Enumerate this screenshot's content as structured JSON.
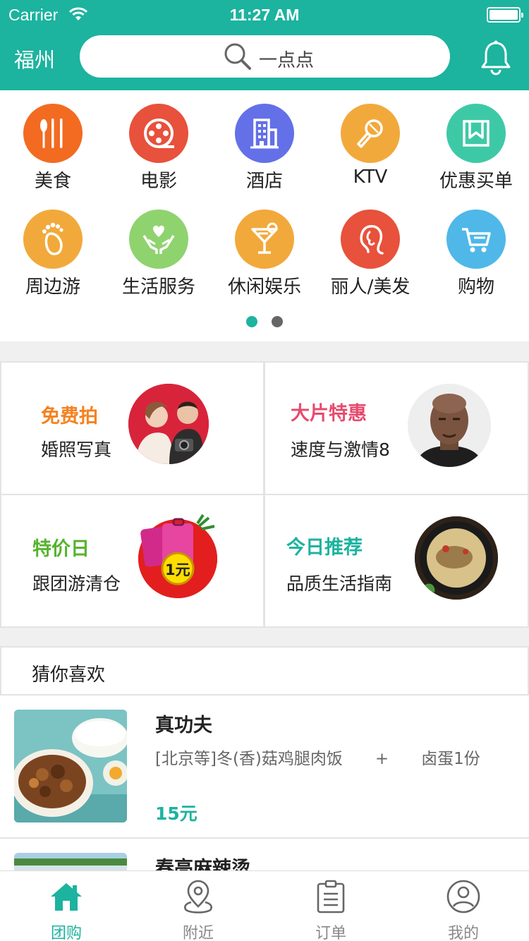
{
  "status_bar": {
    "carrier": "Carrier",
    "time": "11:27 AM"
  },
  "header": {
    "city": "福州",
    "search_placeholder": "一点点"
  },
  "categories": [
    {
      "label": "美食",
      "icon": "utensils-icon",
      "color": "#f26b21"
    },
    {
      "label": "电影",
      "icon": "film-reel-icon",
      "color": "#e8513b"
    },
    {
      "label": "酒店",
      "icon": "building-icon",
      "color": "#6370e8"
    },
    {
      "label": "KTV",
      "icon": "microphone-icon",
      "color": "#f2a93b"
    },
    {
      "label": "优惠买单",
      "icon": "bookmark-icon",
      "color": "#3ec9a6"
    },
    {
      "label": "周边游",
      "icon": "footprint-icon",
      "color": "#f2a93b"
    },
    {
      "label": "生活服务",
      "icon": "heart-hands-icon",
      "color": "#8fd36f"
    },
    {
      "label": "休闲娱乐",
      "icon": "cocktail-icon",
      "color": "#f2a93b"
    },
    {
      "label": "丽人/美发",
      "icon": "woman-profile-icon",
      "color": "#e8513b"
    },
    {
      "label": "购物",
      "icon": "cart-icon",
      "color": "#4fb8e8"
    }
  ],
  "promos": [
    {
      "title": "免费拍",
      "subtitle": "婚照写真",
      "title_color": "#f5821f"
    },
    {
      "title": "大片特惠",
      "subtitle": "速度与激情8",
      "title_color": "#e84a6e"
    },
    {
      "title": "特价日",
      "subtitle": "跟团游清仓",
      "title_color": "#56b32e"
    },
    {
      "title": "今日推荐",
      "subtitle": "品质生活指南",
      "title_color": "#1cb39f"
    }
  ],
  "promo_badge": "1元",
  "recommend": {
    "header": "猜你喜欢",
    "deals": [
      {
        "name": "真功夫",
        "description": "[北京等]冬(香)菇鸡腿肉饭　　+　　卤蛋1份",
        "price": "15元"
      },
      {
        "name": "春亮麻辣烫"
      }
    ]
  },
  "tabs": [
    {
      "label": "团购",
      "icon": "home-icon"
    },
    {
      "label": "附近",
      "icon": "location-pin-icon"
    },
    {
      "label": "订单",
      "icon": "clipboard-icon"
    },
    {
      "label": "我的",
      "icon": "user-icon"
    }
  ],
  "theme": {
    "accent": "#1cb39f"
  }
}
